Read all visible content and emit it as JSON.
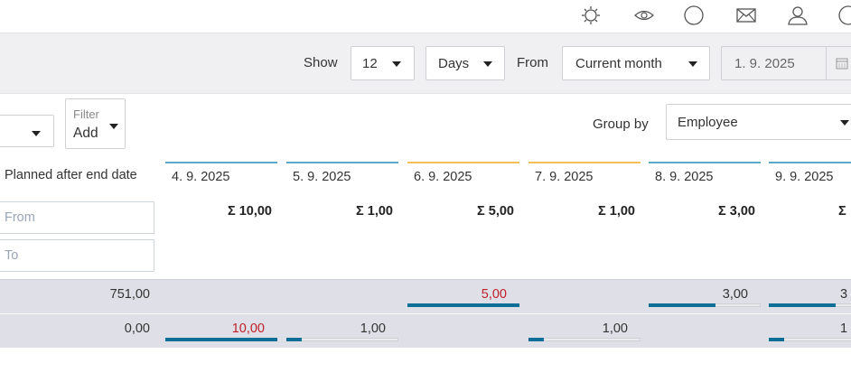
{
  "colors": {
    "accent_blue": "#0d6e97",
    "header_blue": "#5aa9c9",
    "header_orange": "#f0bf57",
    "over_red": "#c0202a"
  },
  "topbar": {
    "icons": [
      "settings-icon",
      "eye-icon",
      "circle-icon",
      "mail-icon",
      "user-icon",
      "circle-icon"
    ]
  },
  "toolbar": {
    "show_label": "Show",
    "count_value": "12",
    "unit_value": "Days",
    "from_label": "From",
    "from_value": "Current month",
    "date_value": "1. 9. 2025"
  },
  "filter": {
    "filter_label": "Filter",
    "add_label": "Add",
    "group_by_label": "Group by",
    "group_by_value": "Employee"
  },
  "grid": {
    "first_column_header": "Planned after end date",
    "from_placeholder": "From",
    "to_placeholder": "To",
    "columns": [
      {
        "date": "4. 9. 2025",
        "sum": "Σ 10,00",
        "accent": "blue"
      },
      {
        "date": "5. 9. 2025",
        "sum": "Σ 1,00",
        "accent": "blue"
      },
      {
        "date": "6. 9. 2025",
        "sum": "Σ 5,00",
        "accent": "orange"
      },
      {
        "date": "7. 9. 2025",
        "sum": "Σ 1,00",
        "accent": "orange"
      },
      {
        "date": "8. 9. 2025",
        "sum": "Σ 3,00",
        "accent": "blue"
      },
      {
        "date": "9. 9. 2025",
        "sum": "Σ",
        "accent": "blue"
      }
    ],
    "rows": [
      {
        "total": "751,00",
        "cells": [
          "",
          "",
          "5,00",
          "",
          "3,00",
          "3"
        ],
        "fill": [
          null,
          null,
          1.0,
          null,
          0.6,
          0.6
        ],
        "over": [
          false,
          false,
          true,
          false,
          false,
          false
        ]
      },
      {
        "total": "0,00",
        "cells": [
          "10,00",
          "1,00",
          "",
          "1,00",
          "",
          "1"
        ],
        "fill": [
          1.0,
          0.14,
          null,
          0.14,
          null,
          0.14
        ],
        "over": [
          true,
          false,
          false,
          false,
          false,
          false
        ]
      }
    ]
  }
}
